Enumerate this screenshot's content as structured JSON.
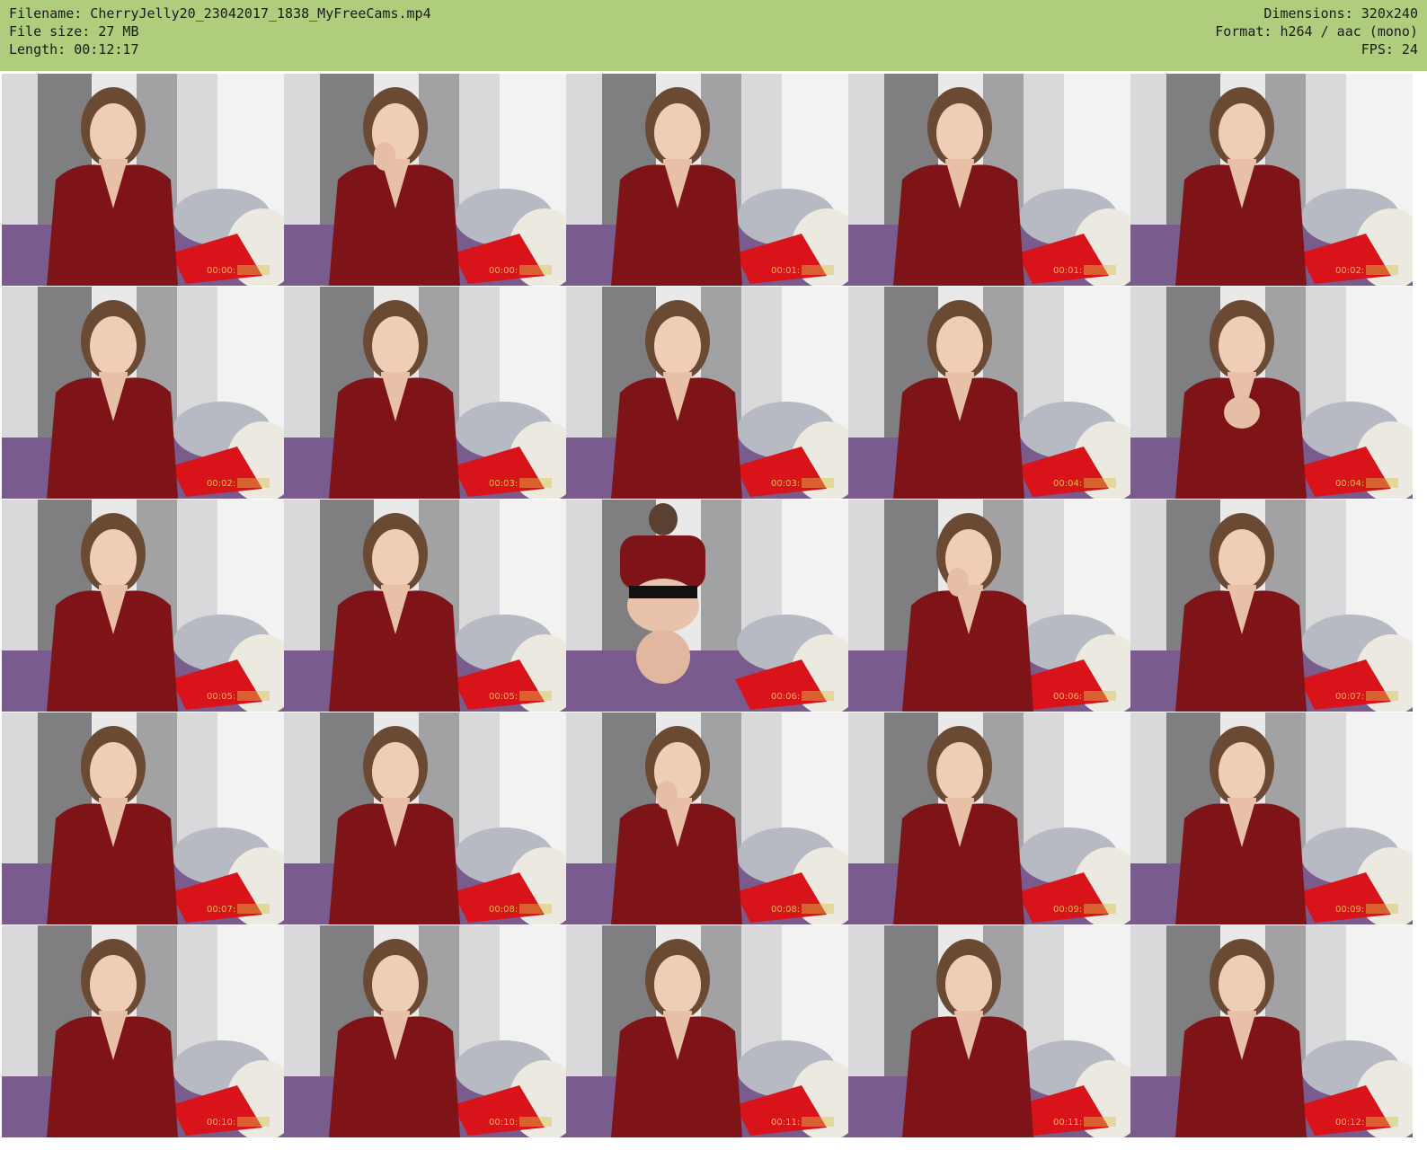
{
  "header": {
    "filename_line": "Filename: CherryJelly20_23042017_1838_MyFreeCams.mp4",
    "filesize_line": "File size: 27 MB",
    "length_line": "Length: 00:12:17",
    "dimensions_line": "Dimensions: 320x240",
    "format_line": "Format: h264 / aac (mono)",
    "fps_line": "FPS: 24"
  },
  "colors": {
    "header_bg": "#afcd7d",
    "shirt": "#7e1418",
    "bedspread": "#7a5b8e",
    "pillow": "#d8131a",
    "curtain": "#6f6f72",
    "timestamp": "#d9c24a"
  },
  "thumbnails": [
    {
      "timestamp": "00:00:",
      "pose": "looking-down"
    },
    {
      "timestamp": "00:00:",
      "pose": "hand-at-mouth"
    },
    {
      "timestamp": "00:01:",
      "pose": "smiling"
    },
    {
      "timestamp": "00:01:",
      "pose": "looking-down"
    },
    {
      "timestamp": "00:02:",
      "pose": "facing-camera"
    },
    {
      "timestamp": "00:02:",
      "pose": "facing-camera"
    },
    {
      "timestamp": "00:03:",
      "pose": "looking-down"
    },
    {
      "timestamp": "00:03:",
      "pose": "looking-side"
    },
    {
      "timestamp": "00:04:",
      "pose": "looking-down"
    },
    {
      "timestamp": "00:04:",
      "pose": "hands-together"
    },
    {
      "timestamp": "00:05:",
      "pose": "looking-down"
    },
    {
      "timestamp": "00:05:",
      "pose": "facing-camera"
    },
    {
      "timestamp": "00:06:",
      "pose": "kneeling-back"
    },
    {
      "timestamp": "00:06:",
      "pose": "laughing"
    },
    {
      "timestamp": "00:07:",
      "pose": "facing-camera"
    },
    {
      "timestamp": "00:07:",
      "pose": "looking-down"
    },
    {
      "timestamp": "00:08:",
      "pose": "looking-down"
    },
    {
      "timestamp": "00:08:",
      "pose": "hand-at-mouth"
    },
    {
      "timestamp": "00:09:",
      "pose": "looking-down"
    },
    {
      "timestamp": "00:09:",
      "pose": "looking-down"
    },
    {
      "timestamp": "00:10:",
      "pose": "facing-camera"
    },
    {
      "timestamp": "00:10:",
      "pose": "looking-down"
    },
    {
      "timestamp": "00:11:",
      "pose": "looking-down"
    },
    {
      "timestamp": "00:11:",
      "pose": "leaning"
    },
    {
      "timestamp": "00:12:",
      "pose": "facing-camera"
    }
  ]
}
